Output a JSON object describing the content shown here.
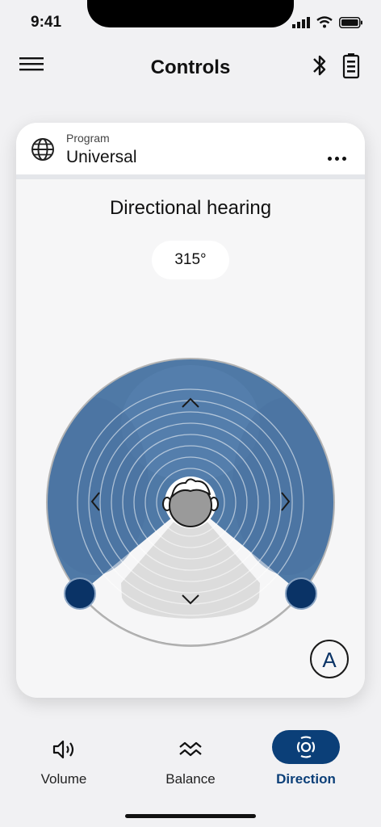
{
  "status_bar": {
    "time": "9:41"
  },
  "header": {
    "title": "Controls"
  },
  "program": {
    "label": "Program",
    "name": "Universal"
  },
  "directional": {
    "title": "Directional hearing",
    "angle": "315°"
  },
  "auto_button": {
    "label": "A"
  },
  "tabs": [
    {
      "label": "Volume",
      "icon": "speaker-icon",
      "active": false
    },
    {
      "label": "Balance",
      "icon": "waves-icon",
      "active": false
    },
    {
      "label": "Direction",
      "icon": "direction-icon",
      "active": true
    }
  ],
  "colors": {
    "accent": "#0b3f78",
    "beam": "#4f79a6",
    "handle": "#0a3366"
  }
}
